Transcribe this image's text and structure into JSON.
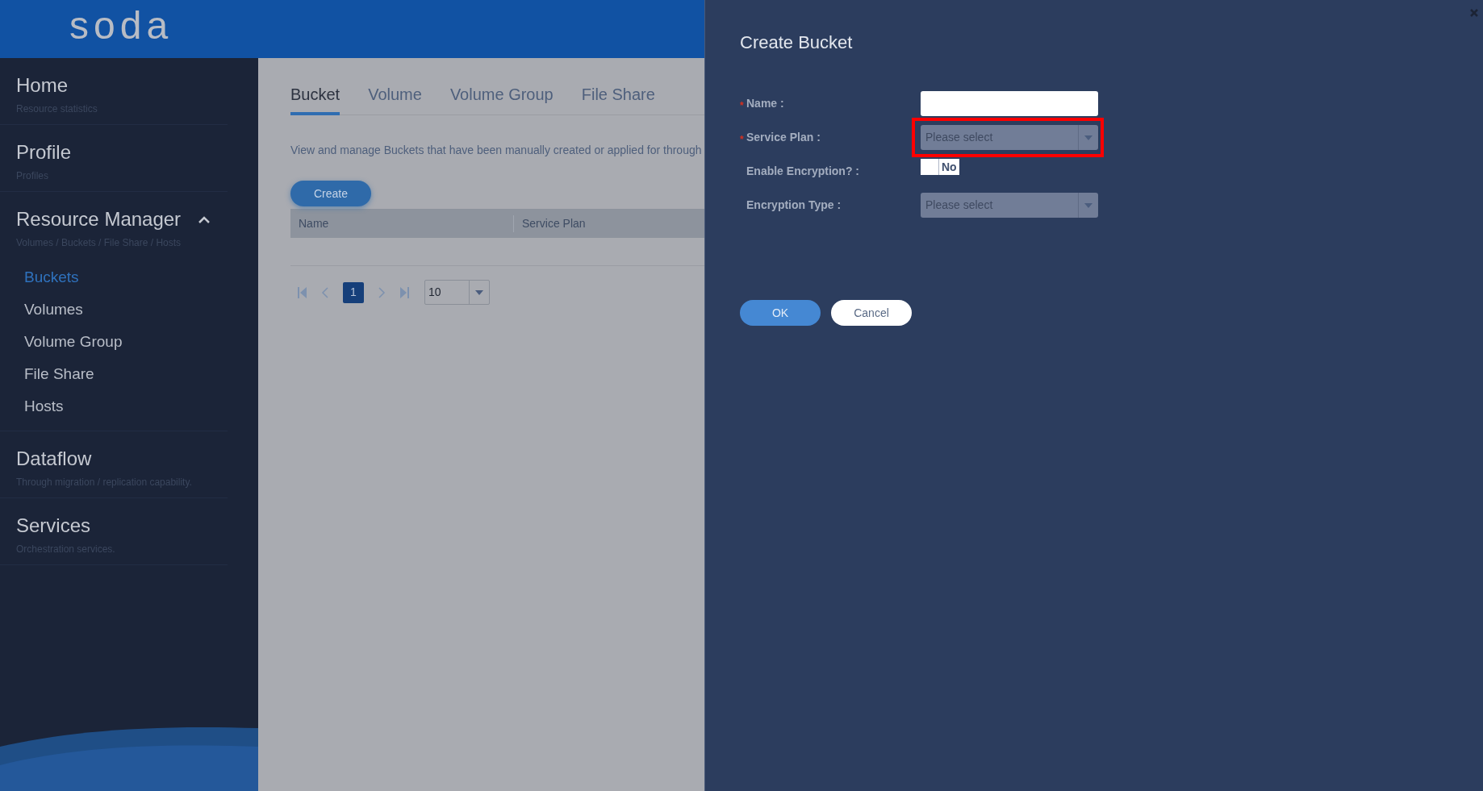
{
  "header": {
    "logo": "soda"
  },
  "sidebar": {
    "items": [
      {
        "title": "Home",
        "subtitle": "Resource statistics",
        "expanded": false
      },
      {
        "title": "Profile",
        "subtitle": "Profiles",
        "expanded": false
      },
      {
        "title": "Resource Manager",
        "subtitle": "Volumes / Buckets / File Share / Hosts",
        "expanded": true,
        "children": [
          {
            "label": "Buckets",
            "selected": true
          },
          {
            "label": "Volumes",
            "selected": false
          },
          {
            "label": "Volume Group",
            "selected": false
          },
          {
            "label": "File Share",
            "selected": false
          },
          {
            "label": "Hosts",
            "selected": false
          }
        ]
      },
      {
        "title": "Dataflow",
        "subtitle": "Through migration / replication capability.",
        "expanded": false
      },
      {
        "title": "Services",
        "subtitle": "Orchestration services.",
        "expanded": false
      }
    ]
  },
  "tabs": [
    {
      "label": "Bucket",
      "selected": true
    },
    {
      "label": "Volume",
      "selected": false
    },
    {
      "label": "Volume Group",
      "selected": false
    },
    {
      "label": "File Share",
      "selected": false
    }
  ],
  "description": "View and manage Buckets that have been manually created or applied for through",
  "create_button": "Create",
  "table": {
    "columns": [
      "Name",
      "Service Plan"
    ]
  },
  "pagination": {
    "pages": [
      {
        "label": "1",
        "selected": true
      }
    ],
    "page_size": "10"
  },
  "dialog": {
    "title": "Create Bucket",
    "fields": [
      {
        "kind": "text",
        "label": "Name :",
        "required_mark": "*",
        "highlighted": false
      },
      {
        "kind": "select",
        "label": "Service Plan :",
        "required_mark": "*",
        "placeholder": "Please select",
        "highlighted": true
      },
      {
        "kind": "toggle",
        "label": "Enable Encryption? :",
        "value": "No",
        "on": false,
        "highlighted": false
      },
      {
        "kind": "select",
        "label": "Encryption Type :",
        "placeholder": "Please select",
        "highlighted": false
      }
    ],
    "buttons": [
      {
        "kind": "primary",
        "label": "OK"
      },
      {
        "kind": "secondary",
        "label": "Cancel"
      }
    ]
  }
}
